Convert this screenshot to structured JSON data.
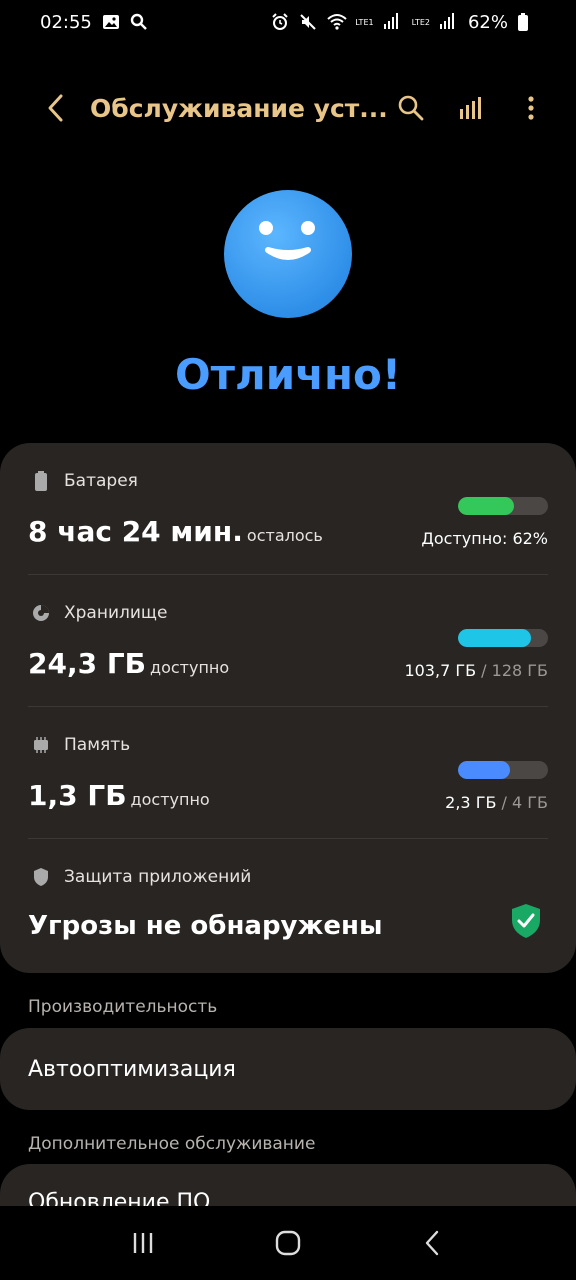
{
  "status_bar": {
    "time": "02:55",
    "battery_percent": "62%",
    "sim1": "LTE1",
    "sim2": "LTE2",
    "left_icons": [
      "image-icon",
      "search-icon"
    ],
    "right_icons": [
      "alarm-icon",
      "mute-icon",
      "wifi-icon",
      "signal-icon",
      "signal-icon",
      "battery-icon"
    ]
  },
  "app_bar": {
    "title": "Обслуживание уст...",
    "icons": [
      "back-icon",
      "search-icon",
      "chart-icon",
      "more-vert-icon"
    ],
    "accent_color": "#e8c589"
  },
  "hero": {
    "status": "Отлично!",
    "status_color": "#4a9cff",
    "face_color": "#2f8fe8"
  },
  "device_card": {
    "battery": {
      "label": "Батарея",
      "value": "8 час 24 мин.",
      "suffix": "осталось",
      "caption": "Доступно: 62%",
      "level_percent": 62,
      "color": "#34c759"
    },
    "storage": {
      "label": "Хранилище",
      "value": "24,3 ГБ",
      "suffix": "доступно",
      "used": "103,7 ГБ",
      "total": "/ 128 ГБ",
      "level_percent": 81,
      "color": "#1ec5e6"
    },
    "memory": {
      "label": "Память",
      "value": "1,3 ГБ",
      "suffix": "доступно",
      "used": "2,3 ГБ",
      "total": "/ 4 ГБ",
      "level_percent": 58,
      "color": "#4a8cff"
    },
    "app_protection": {
      "label": "Защита приложений",
      "value": "Угрозы не обнаружены",
      "shield_color": "#1aa865"
    }
  },
  "performance": {
    "header": "Производительность",
    "item": "Автооптимизация"
  },
  "additional": {
    "header": "Дополнительное обслуживание",
    "item": "Обновление ПО"
  },
  "nav_bar": {
    "icons": [
      "recents-icon",
      "home-icon",
      "back-icon"
    ]
  }
}
